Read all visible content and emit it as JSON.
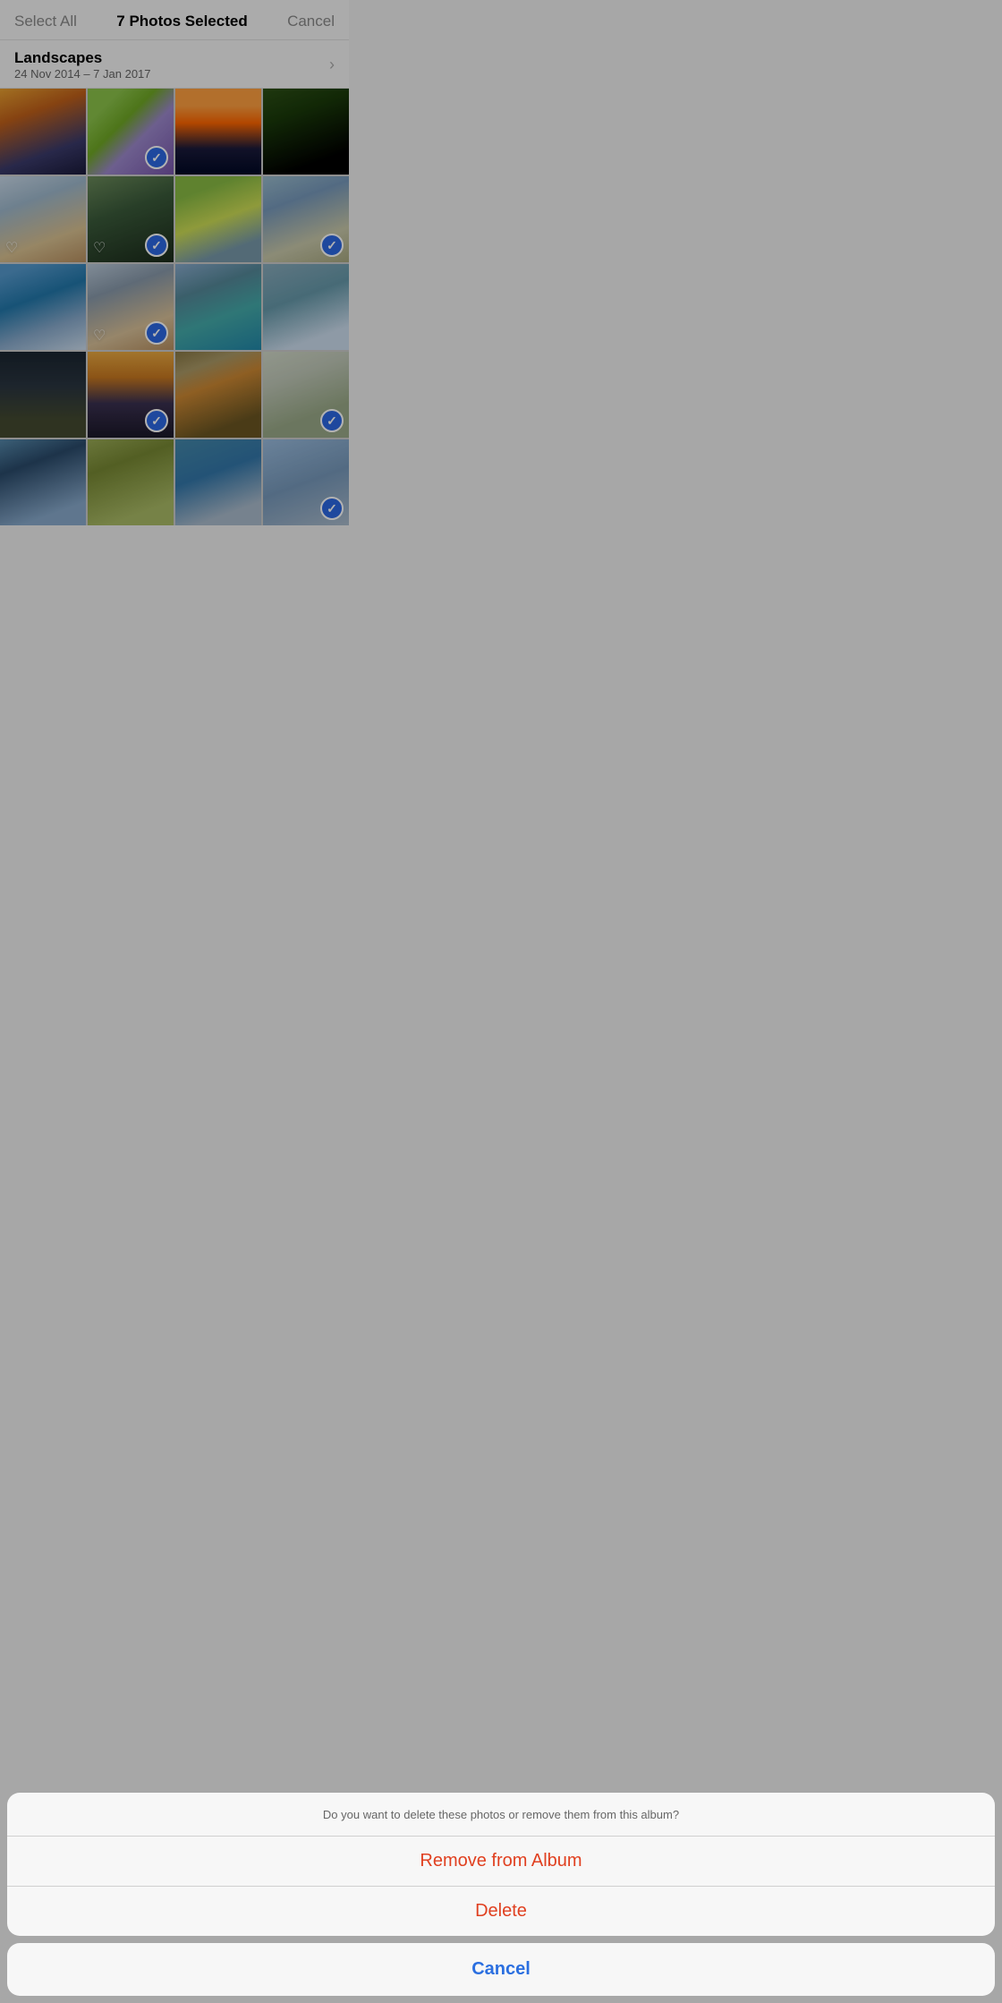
{
  "header": {
    "select_all_label": "Select All",
    "title": "7 Photos Selected",
    "cancel_label": "Cancel"
  },
  "album": {
    "title": "Landscapes",
    "dates": "24 Nov 2014 – 7 Jan 2017"
  },
  "photos": [
    {
      "id": 1,
      "selected": false,
      "favorited": false,
      "css": "photo-1"
    },
    {
      "id": 2,
      "selected": true,
      "favorited": false,
      "css": "photo-2"
    },
    {
      "id": 3,
      "selected": false,
      "favorited": false,
      "css": "photo-3"
    },
    {
      "id": 4,
      "selected": false,
      "favorited": false,
      "css": "photo-4"
    },
    {
      "id": 5,
      "selected": false,
      "favorited": true,
      "css": "photo-5"
    },
    {
      "id": 6,
      "selected": true,
      "favorited": true,
      "css": "photo-6"
    },
    {
      "id": 7,
      "selected": false,
      "favorited": false,
      "css": "photo-7"
    },
    {
      "id": 8,
      "selected": true,
      "favorited": false,
      "css": "photo-8"
    },
    {
      "id": 9,
      "selected": false,
      "favorited": false,
      "css": "photo-9"
    },
    {
      "id": 10,
      "selected": true,
      "favorited": true,
      "css": "photo-10"
    },
    {
      "id": 11,
      "selected": false,
      "favorited": false,
      "css": "photo-11"
    },
    {
      "id": 12,
      "selected": false,
      "favorited": false,
      "css": "photo-12"
    },
    {
      "id": 13,
      "selected": false,
      "favorited": false,
      "css": "photo-13"
    },
    {
      "id": 14,
      "selected": true,
      "favorited": false,
      "css": "photo-14"
    },
    {
      "id": 15,
      "selected": false,
      "favorited": false,
      "css": "photo-15"
    },
    {
      "id": 16,
      "selected": true,
      "favorited": false,
      "css": "photo-16"
    },
    {
      "id": 17,
      "selected": false,
      "favorited": false,
      "css": "photo-17"
    },
    {
      "id": 18,
      "selected": false,
      "favorited": false,
      "css": "photo-18"
    },
    {
      "id": 19,
      "selected": false,
      "favorited": false,
      "css": "photo-19"
    },
    {
      "id": 20,
      "selected": true,
      "favorited": false,
      "css": "photo-20"
    }
  ],
  "action_sheet": {
    "message": "Do you want to delete these photos or remove them from this album?",
    "remove_label": "Remove from Album",
    "delete_label": "Delete",
    "cancel_label": "Cancel"
  }
}
